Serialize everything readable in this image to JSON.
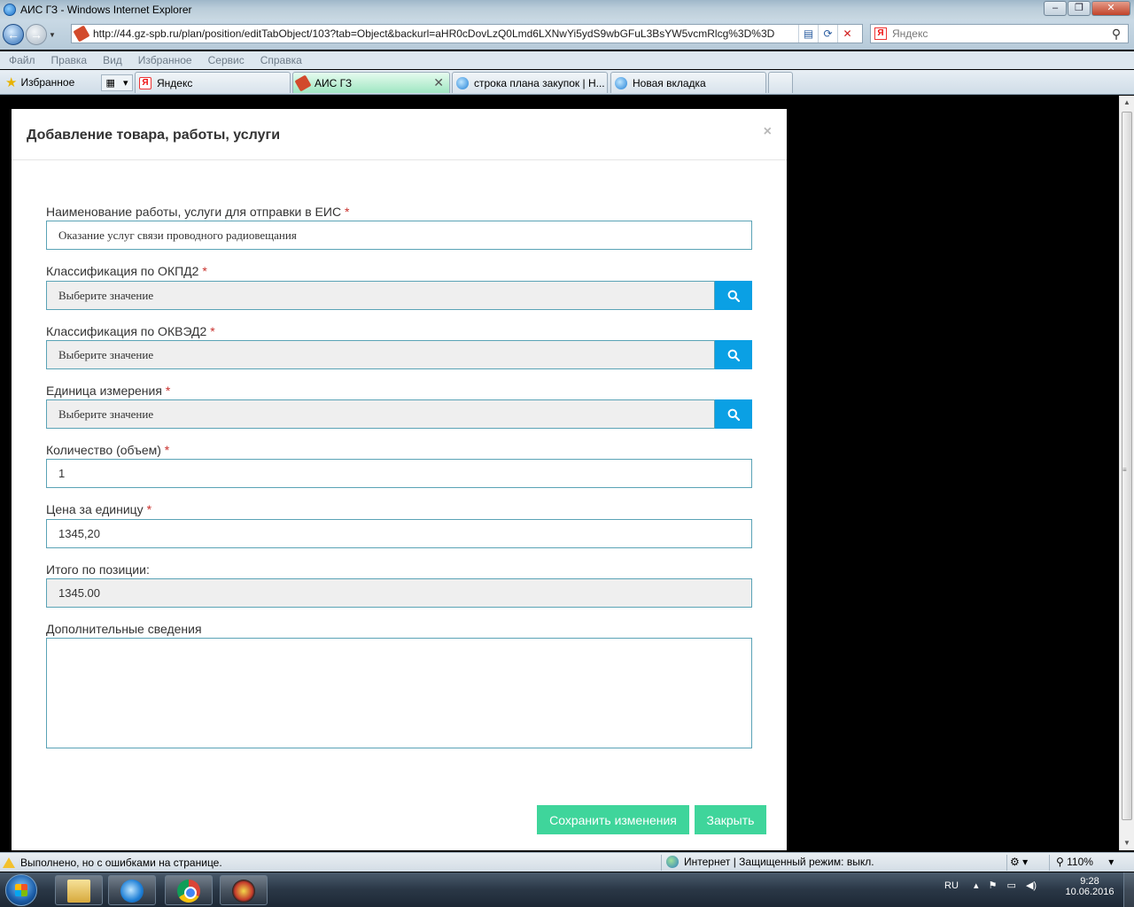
{
  "window": {
    "title": "АИС ГЗ - Windows Internet Explorer"
  },
  "address": {
    "url": "http://44.gz-spb.ru/plan/position/editTabObject/103?tab=Object&backurl=aHR0cDovLzQ0Lmd6LXNwYi5ydS9wbGFuL3BsYW5vcmRlcg%3D%3D"
  },
  "search": {
    "placeholder": "Яндекс"
  },
  "menu": [
    "Файл",
    "Правка",
    "Вид",
    "Избранное",
    "Сервис",
    "Справка"
  ],
  "favorites": {
    "label": "Избранное"
  },
  "tabs": [
    {
      "label": "Яндекс",
      "icon": "yandex-icon",
      "active": false
    },
    {
      "label": "АИС ГЗ",
      "icon": "site-icon",
      "active": true
    },
    {
      "label": "строка плана закупок | Н...",
      "icon": "ie-page-icon",
      "active": false
    },
    {
      "label": "Новая вкладка",
      "icon": "ie-page-icon",
      "active": false
    }
  ],
  "modal": {
    "title": "Добавление товара, работы, услуги",
    "close": "×",
    "required_mark": "*",
    "fields": {
      "name": {
        "label": "Наименование работы, услуги для отправки в ЕИС",
        "value": "Оказание услуг связи проводного радиовещания"
      },
      "okpd2": {
        "label": "Классификация по ОКПД2",
        "value": "Выберите значение"
      },
      "okved2": {
        "label": "Классификация по ОКВЭД2",
        "value": "Выберите значение"
      },
      "unit": {
        "label": "Единица измерения",
        "value": "Выберите значение"
      },
      "quantity": {
        "label": "Количество (объем)",
        "value": "1"
      },
      "price": {
        "label": "Цена за единицу",
        "value": "1345,20"
      },
      "total": {
        "label": "Итого по позиции:",
        "value": "1345.00"
      },
      "extra": {
        "label": "Дополнительные сведения",
        "value": ""
      }
    },
    "buttons": {
      "save": "Сохранить изменения",
      "close": "Закрыть"
    }
  },
  "status": {
    "text": "Выполнено, но с ошибками на странице.",
    "zone": "Интернет | Защищенный режим: выкл.",
    "zoom": "110%"
  },
  "taskbar": {
    "lang": "RU",
    "time": "9:28",
    "date": "10.06.2016"
  },
  "colors": {
    "accent_button": "#3fd59b",
    "search_button": "#0aa0e4",
    "input_border": "#5aa3b6"
  }
}
